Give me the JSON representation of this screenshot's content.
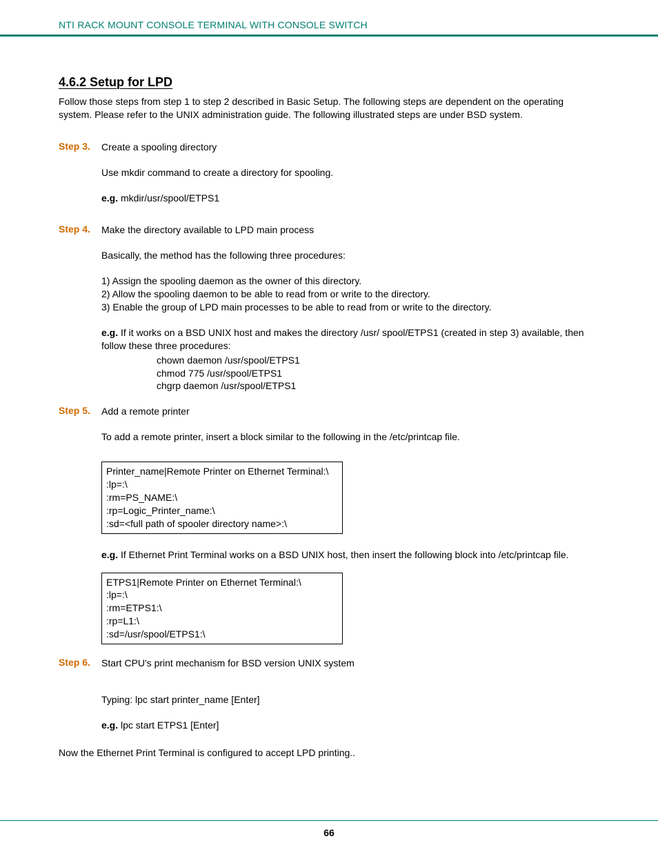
{
  "header": "NTI RACK MOUNT CONSOLE TERMINAL WITH CONSOLE SWITCH",
  "section_title": "4.6.2 Setup for LPD",
  "intro": "Follow those steps from step 1 to step 2 described in Basic Setup. The following steps are dependent on the operating system. Please refer to the UNIX administration guide. The following illustrated steps are under BSD system.",
  "step3": {
    "label": "Step 3.",
    "title": "Create a spooling directory",
    "p1": "Use mkdir command to create a directory for spooling.",
    "eg_label": "e.g.",
    "eg_text": " mkdir/usr/spool/ETPS1"
  },
  "step4": {
    "label": "Step 4.",
    "title": "Make the directory available to LPD main process",
    "p1": "Basically, the method has the following three procedures:",
    "li1": "1) Assign the spooling daemon as the owner of this directory.",
    "li2": "2) Allow the spooling daemon to be able to read from or write to the directory.",
    "li3": "3) Enable the group of LPD main processes to be able to read from or write to the directory.",
    "eg_label": "e.g.",
    "eg_text": " If it works on a BSD UNIX host and makes the directory /usr/ spool/ETPS1 (created in step 3) available, then follow these three procedures:",
    "cmd1": "chown daemon /usr/spool/ETPS1",
    "cmd2": "chmod 775 /usr/spool/ETPS1",
    "cmd3": "chgrp daemon /usr/spool/ETPS1"
  },
  "step5": {
    "label": "Step 5.",
    "title": "Add a remote printer",
    "p1": "To add a remote printer, insert a block similar to the following in the /etc/printcap file.",
    "box1": {
      "l1": "Printer_name|Remote Printer on Ethernet Terminal:\\",
      "l2": ":lp=:\\",
      "l3": ":rm=PS_NAME:\\",
      "l4": ":rp=Logic_Printer_name:\\",
      "l5": ":sd=<full path of spooler directory name>:\\"
    },
    "eg_label": "e.g.",
    "eg_text": " If Ethernet Print Terminal works on a BSD UNIX host, then insert the following block into /etc/printcap file.",
    "box2": {
      "l1": "ETPS1|Remote Printer on Ethernet Terminal:\\",
      "l2": ":lp=:\\",
      "l3": ":rm=ETPS1:\\",
      "l4": ":rp=L1:\\",
      "l5": ":sd=/usr/spool/ETPS1:\\"
    }
  },
  "step6": {
    "label": "Step 6.",
    "title": "Start CPU's print mechanism for BSD version UNIX system",
    "p1": "Typing: lpc start printer_name [Enter]",
    "eg_label": "e.g.",
    "eg_text": " lpc start ETPS1 [Enter]"
  },
  "conclusion": "Now the Ethernet Print Terminal is configured to accept LPD printing..",
  "page_number": "66"
}
